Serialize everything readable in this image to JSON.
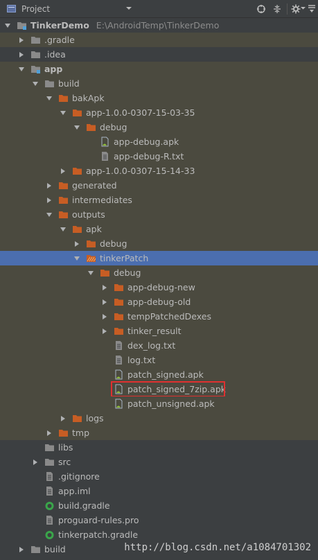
{
  "toolbar": {
    "title": "Project"
  },
  "tree": [
    {
      "name": "tree-item-tinkerdemo",
      "label": "TinkerDemo",
      "path": "E:\\AndroidTemp\\TinkerDemo",
      "depth": 0,
      "arrow": "down",
      "icon": "module",
      "bold": true
    },
    {
      "name": "tree-item-gradle-dir",
      "label": ".gradle",
      "depth": 1,
      "arrow": "right",
      "icon": "folder-gray",
      "alt": true
    },
    {
      "name": "tree-item-idea",
      "label": ".idea",
      "depth": 1,
      "arrow": "right",
      "icon": "folder-gray"
    },
    {
      "name": "tree-item-app",
      "label": "app",
      "depth": 1,
      "arrow": "down",
      "icon": "module",
      "bold": true,
      "alt": true
    },
    {
      "name": "tree-item-build",
      "label": "build",
      "depth": 2,
      "arrow": "down",
      "icon": "folder-gray",
      "alt": true
    },
    {
      "name": "tree-item-bakapk",
      "label": "bakApk",
      "depth": 3,
      "arrow": "down",
      "icon": "folder-orange",
      "alt": true
    },
    {
      "name": "tree-item-app-1-0-0-0307-15-03-35",
      "label": "app-1.0.0-0307-15-03-35",
      "depth": 4,
      "arrow": "down",
      "icon": "folder-orange",
      "alt": true
    },
    {
      "name": "tree-item-debug-1",
      "label": "debug",
      "depth": 5,
      "arrow": "down",
      "icon": "folder-orange",
      "alt": true
    },
    {
      "name": "tree-item-app-debug-apk",
      "label": "app-debug.apk",
      "depth": 6,
      "arrow": "none",
      "icon": "apk",
      "alt": true
    },
    {
      "name": "tree-item-app-debug-r-txt",
      "label": "app-debug-R.txt",
      "depth": 6,
      "arrow": "none",
      "icon": "text",
      "alt": true
    },
    {
      "name": "tree-item-app-1-0-0-0307-15-14-33",
      "label": "app-1.0.0-0307-15-14-33",
      "depth": 4,
      "arrow": "right",
      "icon": "folder-orange",
      "alt": true
    },
    {
      "name": "tree-item-generated",
      "label": "generated",
      "depth": 3,
      "arrow": "right",
      "icon": "folder-orange",
      "alt": true
    },
    {
      "name": "tree-item-intermediates",
      "label": "intermediates",
      "depth": 3,
      "arrow": "right",
      "icon": "folder-orange",
      "alt": true
    },
    {
      "name": "tree-item-outputs",
      "label": "outputs",
      "depth": 3,
      "arrow": "down",
      "icon": "folder-orange",
      "alt": true
    },
    {
      "name": "tree-item-apk",
      "label": "apk",
      "depth": 4,
      "arrow": "down",
      "icon": "folder-orange",
      "alt": true
    },
    {
      "name": "tree-item-debug-2",
      "label": "debug",
      "depth": 5,
      "arrow": "right",
      "icon": "folder-orange",
      "alt": true
    },
    {
      "name": "tree-item-tinkerpatch",
      "label": "tinkerPatch",
      "depth": 5,
      "arrow": "down",
      "icon": "folder-orange-hatched",
      "selected": true
    },
    {
      "name": "tree-item-debug-3",
      "label": "debug",
      "depth": 6,
      "arrow": "down",
      "icon": "folder-orange",
      "alt": true
    },
    {
      "name": "tree-item-app-debug-new",
      "label": "app-debug-new",
      "depth": 7,
      "arrow": "right",
      "icon": "folder-orange",
      "alt": true
    },
    {
      "name": "tree-item-app-debug-old",
      "label": "app-debug-old",
      "depth": 7,
      "arrow": "right",
      "icon": "folder-orange",
      "alt": true
    },
    {
      "name": "tree-item-temppatcheddexes",
      "label": "tempPatchedDexes",
      "depth": 7,
      "arrow": "right",
      "icon": "folder-orange",
      "alt": true
    },
    {
      "name": "tree-item-tinker-result",
      "label": "tinker_result",
      "depth": 7,
      "arrow": "right",
      "icon": "folder-orange",
      "alt": true
    },
    {
      "name": "tree-item-dex-log-txt",
      "label": "dex_log.txt",
      "depth": 7,
      "arrow": "none",
      "icon": "text",
      "alt": true
    },
    {
      "name": "tree-item-log-txt",
      "label": "log.txt",
      "depth": 7,
      "arrow": "none",
      "icon": "text",
      "alt": true
    },
    {
      "name": "tree-item-patch-signed-apk",
      "label": "patch_signed.apk",
      "depth": 7,
      "arrow": "none",
      "icon": "apk",
      "alt": true
    },
    {
      "name": "tree-item-patch-signed-7zip-apk",
      "label": "patch_signed_7zip.apk",
      "depth": 7,
      "arrow": "none",
      "icon": "apk",
      "alt": true,
      "highlight": true
    },
    {
      "name": "tree-item-patch-unsigned-apk",
      "label": "patch_unsigned.apk",
      "depth": 7,
      "arrow": "none",
      "icon": "apk",
      "alt": true
    },
    {
      "name": "tree-item-logs",
      "label": "logs",
      "depth": 4,
      "arrow": "right",
      "icon": "folder-orange",
      "alt": true
    },
    {
      "name": "tree-item-tmp",
      "label": "tmp",
      "depth": 3,
      "arrow": "right",
      "icon": "folder-orange",
      "alt": true
    },
    {
      "name": "tree-item-libs",
      "label": "libs",
      "depth": 2,
      "arrow": "none",
      "icon": "folder-gray"
    },
    {
      "name": "tree-item-src",
      "label": "src",
      "depth": 2,
      "arrow": "right",
      "icon": "folder-gray"
    },
    {
      "name": "tree-item-gitignore",
      "label": ".gitignore",
      "depth": 2,
      "arrow": "none",
      "icon": "text"
    },
    {
      "name": "tree-item-app-iml",
      "label": "app.iml",
      "depth": 2,
      "arrow": "none",
      "icon": "text"
    },
    {
      "name": "tree-item-build-gradle",
      "label": "build.gradle",
      "depth": 2,
      "arrow": "none",
      "icon": "gradle"
    },
    {
      "name": "tree-item-proguard-rules-pro",
      "label": "proguard-rules.pro",
      "depth": 2,
      "arrow": "none",
      "icon": "text"
    },
    {
      "name": "tree-item-tinkerpatch-gradle",
      "label": "tinkerpatch.gradle",
      "depth": 2,
      "arrow": "none",
      "icon": "gradle"
    },
    {
      "name": "tree-item-build-root",
      "label": "build",
      "depth": 1,
      "arrow": "right",
      "icon": "folder-gray"
    }
  ],
  "watermark": "http://blog.csdn.net/a1084701302",
  "colors": {
    "folder_orange": "#c75d24",
    "folder_gray": "#8a8a8a",
    "selection": "#4b6eaf",
    "highlight_border": "#e03030"
  }
}
